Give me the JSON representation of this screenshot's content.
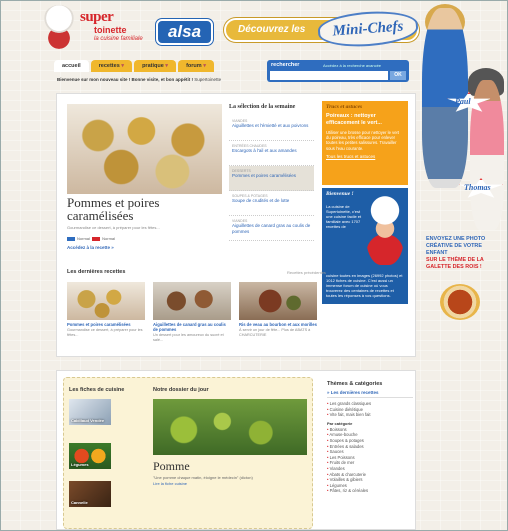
{
  "header": {
    "logo_line1": "super",
    "logo_line2": "toinette",
    "logo_tagline": "la cuisine familiale",
    "alsa": "alsa",
    "banner_text": "Découvrez les",
    "banner_script": "Mini-Chefs"
  },
  "nav": {
    "tabs": [
      {
        "label": "accueil"
      },
      {
        "label": "recettes",
        "arrow": "▾"
      },
      {
        "label": "pratique",
        "arrow": "▾"
      },
      {
        "label": "forum",
        "arrow": "▾"
      }
    ]
  },
  "search": {
    "label": "rechercher",
    "advanced": "Accédez à la recherche avancée",
    "button": "OK",
    "placeholder": ""
  },
  "welcome": {
    "bold": "Bienvenue sur mon nouveau site ! Bonne visite, et bon appétit !",
    "sign": "Supertoinette"
  },
  "feature": {
    "title": "Pommes et poires caramélisées",
    "desc": "Gourmandise ce dessert, à préparer pour les fêtes...",
    "level1": "Normal",
    "level2": "Normal",
    "link": "Accédez à la recette »"
  },
  "selection": {
    "heading": "La sélection de la semaine",
    "items": [
      {
        "cat": "Viandes",
        "name": "Aiguillettes et l'émietté et aux poivrons"
      },
      {
        "cat": "Entrées chaudes",
        "name": "Escargots à l'ail et aux amandes"
      },
      {
        "cat": "Desserts",
        "name": "Pommes et poires caramélisées"
      },
      {
        "cat": "Soupes & potages",
        "name": "Soupe de crudités et de lotte"
      },
      {
        "cat": "Viandes",
        "name": "Aiguillettes de canard gras au coulis de pommes"
      }
    ]
  },
  "tricks": {
    "heading": "Trucs et astuces",
    "title": "Poireaux : nettoyer efficacement le vert...",
    "desc": "Utiliser une brosse pour nettoyer le vert du poireau, très efficace pour enlever toutes les petites salissures. Travailler sous l'eau courante.",
    "link": "Tous les trucs et astuces"
  },
  "welcomebox": {
    "heading": "Bienvenue !",
    "desc1": "La cuisine de Supertoinette, c'est une cuisine facile et familiale avec 1707 recettes de",
    "desc2": "cuisine toutes en images (26992 photos) et 1012 fiches de cuisine. C'est aussi un immense forum de cuisine où vous trouverez des centaines de recettes et toutes les réponses à vos questions."
  },
  "lastrecipes": {
    "heading": "Les dernières recettes",
    "prev": "Recettes précédentes",
    "cards": [
      {
        "name": "Pommes et poires caramélisées",
        "desc": "Gourmandise ce dessert, à préparer pour les fêtes..."
      },
      {
        "name": "Aiguillettes de canard gras au coulis de pommes",
        "desc": "Un dessert pour les amoureux du sucré et salé..."
      },
      {
        "name": "Ris de veau au bourbon et aux morilles",
        "desc": "À servir un jour de fête... Plus de ABATS à CHARCUTERIE"
      }
    ]
  },
  "dossier": {
    "fiches": "Les fiches de cuisine",
    "thumbs": [
      "Cabillaud Vendée",
      "Légumes",
      "Cannelle"
    ],
    "heading": "Notre dossier du jour",
    "title": "Pomme",
    "quote": "\"Une pomme chaque matin, éloigne le médecin\" (dicton)",
    "link": "Lire la fiche cuisine"
  },
  "themes": {
    "heading": "Thèmes & catégories",
    "sub": "» Les dernières recettes",
    "list1": [
      "Les grands classiques",
      "Cuisine diététique",
      "Vite fait, mais bien fait"
    ],
    "group": "Par catégorie",
    "list2": [
      "Boissons",
      "Amuse-bouche",
      "Soupes & potages",
      "Entrées & salades",
      "Sauces",
      "Les Poissons",
      "Fruits de mer",
      "Viandes",
      "Abats & charcuterie",
      "Volailles & gibiers",
      "Légumes",
      "Pâtes, riz & céréales"
    ]
  },
  "side": {
    "paul": "Paul",
    "thomas": "Thomas",
    "promo1": "ENVOYEZ UNE PHOTO CRÉATIVE DE VOTRE ENFANT",
    "promo2": "SUR LE THÈME DE LA GALETTE DES ROIS !"
  }
}
